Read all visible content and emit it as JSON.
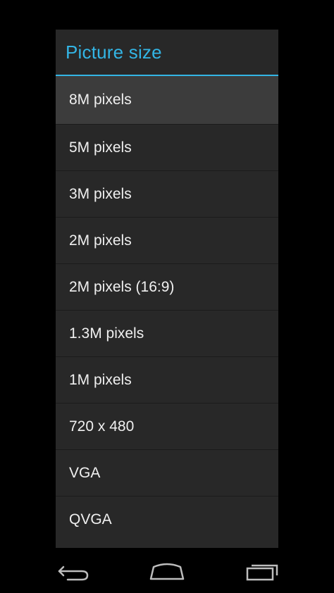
{
  "dialog": {
    "title": "Picture size",
    "accent_color": "#33b5e5",
    "options": [
      {
        "label": "8M pixels",
        "selected": true
      },
      {
        "label": "5M pixels",
        "selected": false
      },
      {
        "label": "3M pixels",
        "selected": false
      },
      {
        "label": "2M pixels",
        "selected": false
      },
      {
        "label": "2M pixels (16:9)",
        "selected": false
      },
      {
        "label": "1.3M pixels",
        "selected": false
      },
      {
        "label": "1M pixels",
        "selected": false
      },
      {
        "label": "720 x 480",
        "selected": false
      },
      {
        "label": "VGA",
        "selected": false
      },
      {
        "label": "QVGA",
        "selected": false
      }
    ]
  },
  "navbar": {
    "back_icon": "back-icon",
    "home_icon": "home-icon",
    "recents_icon": "recents-icon"
  }
}
